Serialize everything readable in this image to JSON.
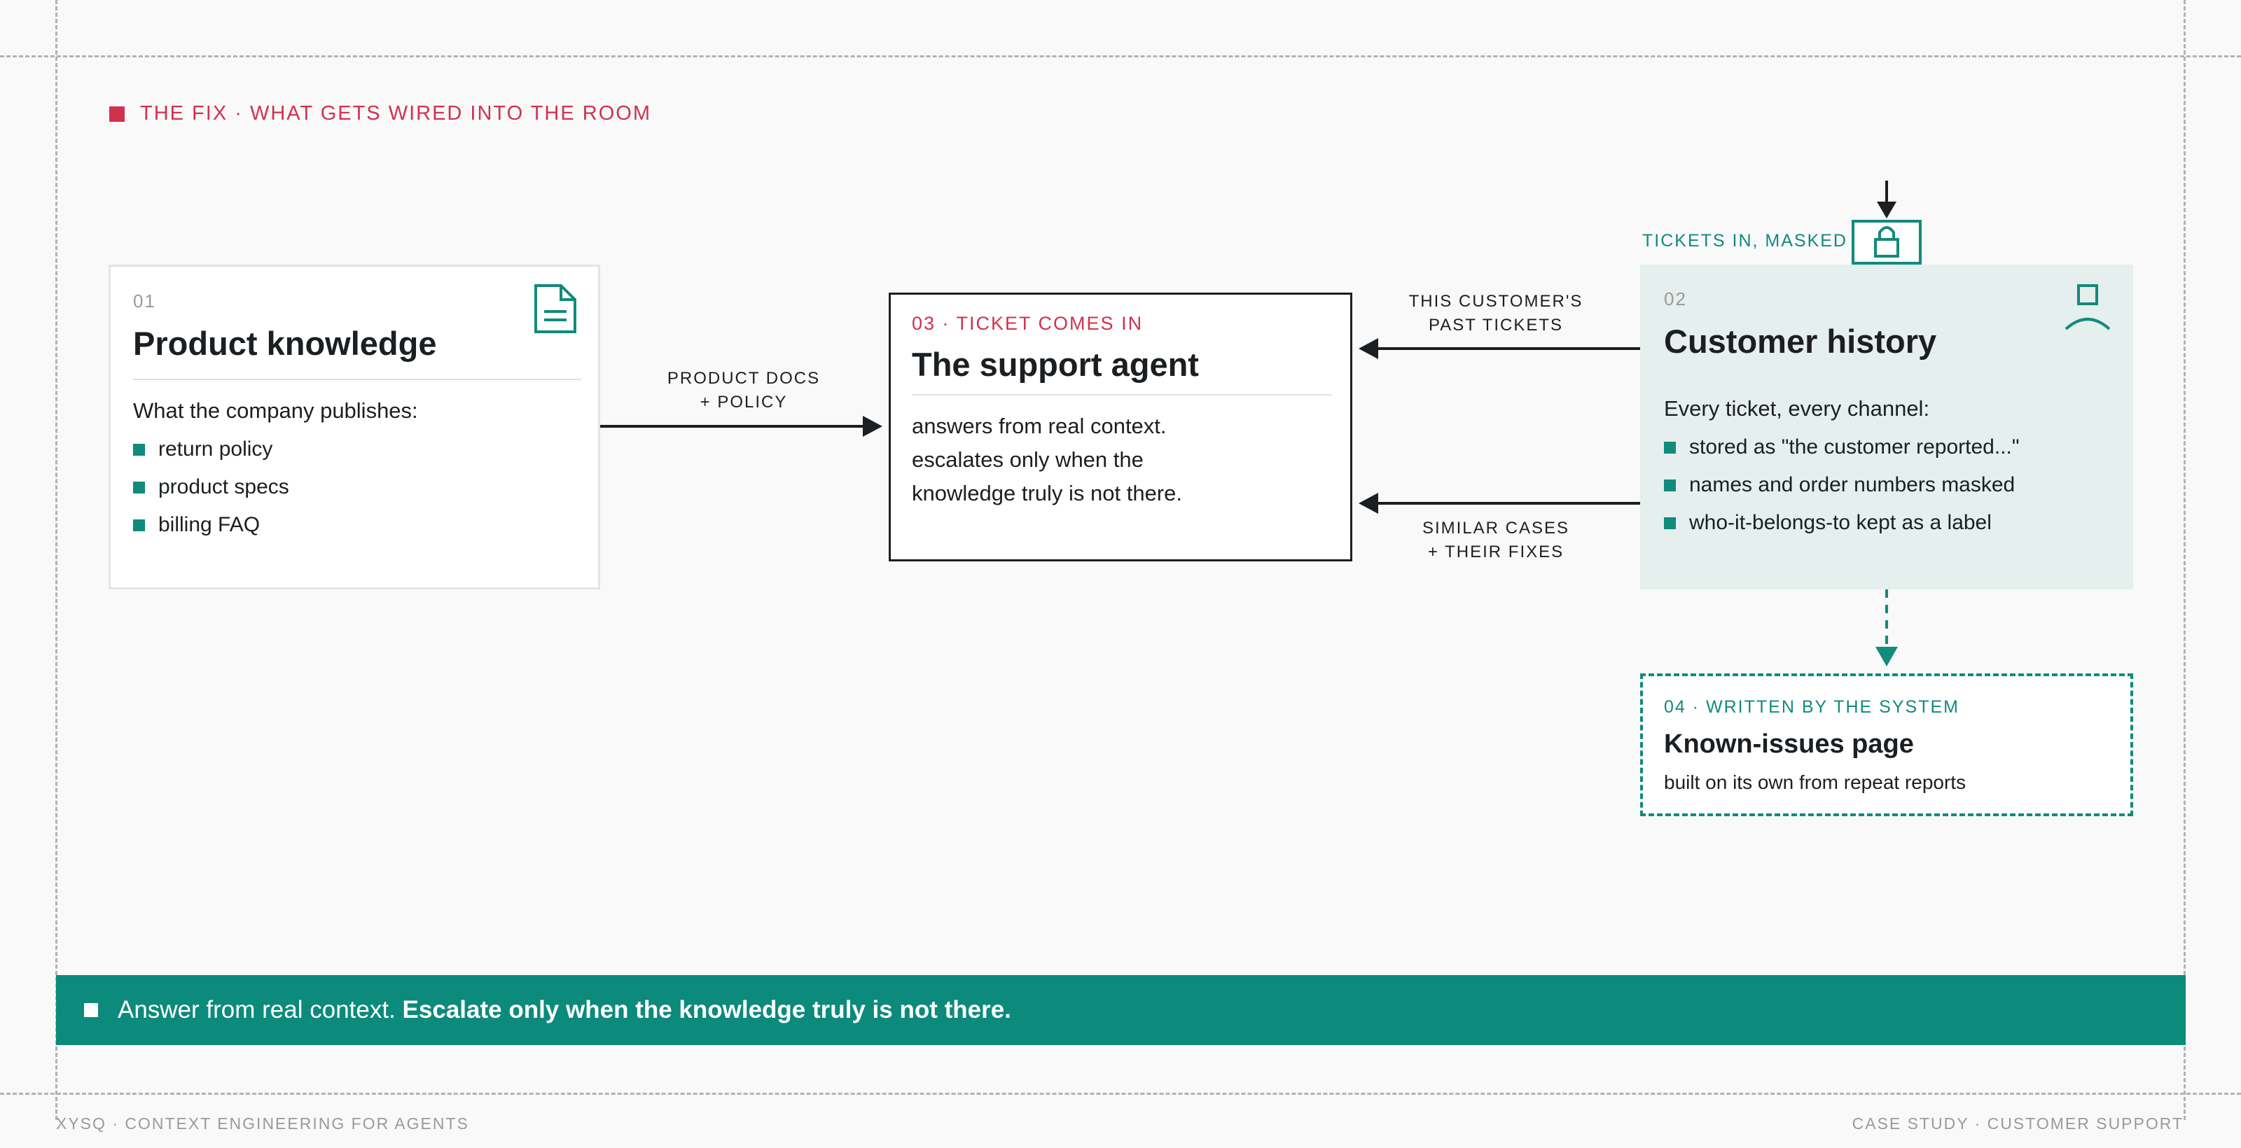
{
  "header": {
    "label": "THE FIX · WHAT GETS WIRED INTO THE ROOM"
  },
  "product": {
    "number": "01",
    "title": "Product knowledge",
    "intro": "What the company publishes:",
    "bullets": [
      "return policy",
      "product specs",
      "billing FAQ"
    ],
    "icon": "document-icon"
  },
  "agent": {
    "kicker": "03 · TICKET COMES IN",
    "title": "The support agent",
    "lines": [
      "answers from real context.",
      "escalates only when the",
      "knowledge truly is not there."
    ]
  },
  "history": {
    "number": "02",
    "title": "Customer history",
    "intro": "Every ticket, every channel:",
    "bullets": [
      "stored as \"the customer reported...\"",
      "names and order numbers masked",
      "who-it-belongs-to kept as a label"
    ],
    "icon": "person-icon"
  },
  "known": {
    "kicker": "04 · WRITTEN BY THE SYSTEM",
    "title": "Known-issues page",
    "desc": "built on its own from repeat reports"
  },
  "edges": {
    "product_to_agent": [
      "PRODUCT DOCS",
      "+ POLICY"
    ],
    "history_past": [
      "THIS CUSTOMER'S",
      "PAST TICKETS"
    ],
    "history_similar": [
      "SIMILAR CASES",
      "+ THEIR FIXES"
    ],
    "tickets_in": "TICKETS IN, MASKED"
  },
  "banner": {
    "text_regular": "Answer from real context.",
    "text_bold": "Escalate only when the knowledge truly is not there."
  },
  "footer": {
    "left": "XYSQ · CONTEXT ENGINEERING FOR AGENTS",
    "right": "CASE STUDY · CUSTOMER SUPPORT"
  },
  "colors": {
    "accent_red": "#d0324d",
    "accent_teal": "#128a7c",
    "banner_bg": "#0c8a7c",
    "history_bg": "#e5efed",
    "ink": "#1b1f22"
  }
}
